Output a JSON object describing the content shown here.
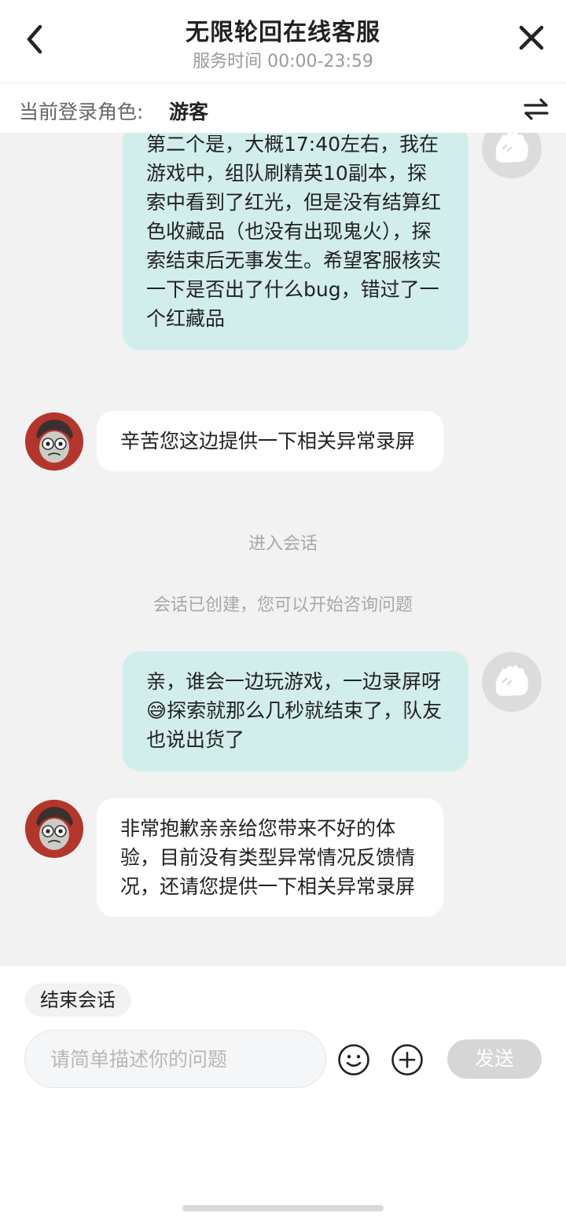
{
  "header": {
    "title": "无限轮回在线客服",
    "subtitle": "服务时间 00:00-23:59"
  },
  "rolebar": {
    "label": "当前登录角色:",
    "value": "游客"
  },
  "messages": [
    {
      "from": "user",
      "text": "第二个是，大概17:40左右，我在游戏中，组队刷精英10副本，探索中看到了红光，但是没有结算红色收藏品（也没有出现鬼火），探索结束后无事发生。希望客服核实一下是否出了什么bug，错过了一个红藏品"
    },
    {
      "from": "agent",
      "text": "辛苦您这边提供一下相关异常录屏"
    },
    {
      "from": "system",
      "text": "进入会话"
    },
    {
      "from": "system",
      "text": "会话已创建，您可以开始咨询问题"
    },
    {
      "from": "user",
      "text_before": "亲，谁会一边玩游戏，一边录屏呀",
      "emoji": "😅",
      "text_after": "探索就那么几秒就结束了，队友也说出货了"
    },
    {
      "from": "agent",
      "text": "非常抱歉亲亲给您带来不好的体验，目前没有类型异常情况反馈情况，还请您提供一下相关异常录屏"
    }
  ],
  "composer": {
    "end_chat_label": "结束会话",
    "input_placeholder": "请简单描述你的问题",
    "input_value": "",
    "send_label": "发送"
  },
  "icons": {
    "back": "chevron-left-icon",
    "close": "close-icon",
    "switch": "swap-arrows-icon",
    "emoji": "smiley-icon",
    "plus": "plus-circle-icon"
  },
  "colors": {
    "user_bubble": "#d2eeec",
    "agent_bubble": "#ffffff",
    "chat_background": "#f2f2f2",
    "send_disabled": "#d6d6d6"
  }
}
